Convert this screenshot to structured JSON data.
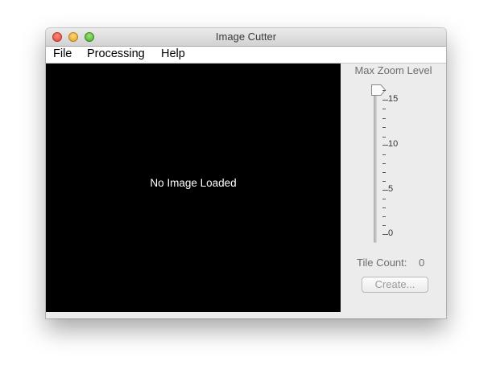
{
  "window": {
    "title": "Image Cutter"
  },
  "menu": {
    "items": [
      "File",
      "Processing",
      "Help"
    ]
  },
  "canvas": {
    "message": "No Image Loaded",
    "background": "#000000"
  },
  "side_panel": {
    "zoom_label": "Max Zoom Level",
    "slider": {
      "min": 0,
      "max": 16,
      "value": 16,
      "major_tick_labels": [
        "15",
        "10",
        "5",
        "0"
      ]
    },
    "tile_count_label": "Tile Count:",
    "tile_count_value": "0",
    "create_button": "Create..."
  }
}
